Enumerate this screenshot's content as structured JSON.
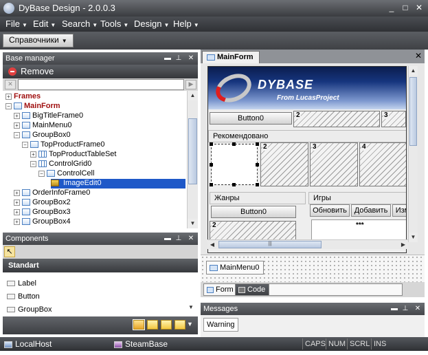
{
  "window": {
    "title": "DyBase Design - 2.0.0.3",
    "buttons": [
      "_",
      "□",
      "✕"
    ]
  },
  "menu": [
    {
      "label": "File"
    },
    {
      "label": "Edit"
    },
    {
      "label": "Search"
    },
    {
      "label": "Tools"
    },
    {
      "label": "Design"
    },
    {
      "label": "Help"
    }
  ],
  "toolbar": {
    "dictionaries_label": "Справочники"
  },
  "base_manager": {
    "title": "Base manager",
    "remove_label": "Remove",
    "search_value": "",
    "tree": [
      {
        "label": "Frames",
        "bold": true
      },
      {
        "label": "MainForm",
        "bold": true
      },
      {
        "label": "BigTitleFrame0"
      },
      {
        "label": "MainMenu0"
      },
      {
        "label": "GroupBox0"
      },
      {
        "label": "TopProductFrame0"
      },
      {
        "label": "TopProductTableSet"
      },
      {
        "label": "ControlGrid0"
      },
      {
        "label": "ControlCell"
      },
      {
        "label": "ImageEdit0",
        "selected": true
      },
      {
        "label": "OrderInfoFrame0"
      },
      {
        "label": "GroupBox2"
      },
      {
        "label": "GroupBox3"
      },
      {
        "label": "GroupBox4"
      }
    ]
  },
  "components": {
    "title": "Components",
    "category": "Standart",
    "items": [
      "Label",
      "Button",
      "GroupBox"
    ]
  },
  "document": {
    "tab_label": "MainForm",
    "logo": {
      "name": "DYBASE",
      "tagline": "From LucasProject"
    },
    "button0_label": "Button0",
    "recommended_label": "Рекомендовано",
    "genres_label": "Жанры",
    "genres_button_label": "Button0",
    "games_label": "Игры",
    "toolbar_buttons": [
      "Обновить",
      "Добавить",
      "Изм"
    ],
    "cell_numbers": [
      "2",
      "3",
      "2",
      "3",
      "4",
      "2"
    ],
    "placeholder_dots": "***",
    "tray_item": "MainMenu0",
    "bottom_tabs": [
      "Form",
      "Code"
    ]
  },
  "messages": {
    "title": "Messages",
    "tab": "Warning"
  },
  "statusbar": {
    "items": [
      "LocalHost",
      "SteamBase"
    ],
    "keys": [
      "CAPS",
      "NUM",
      "SCRL",
      "INS"
    ]
  }
}
